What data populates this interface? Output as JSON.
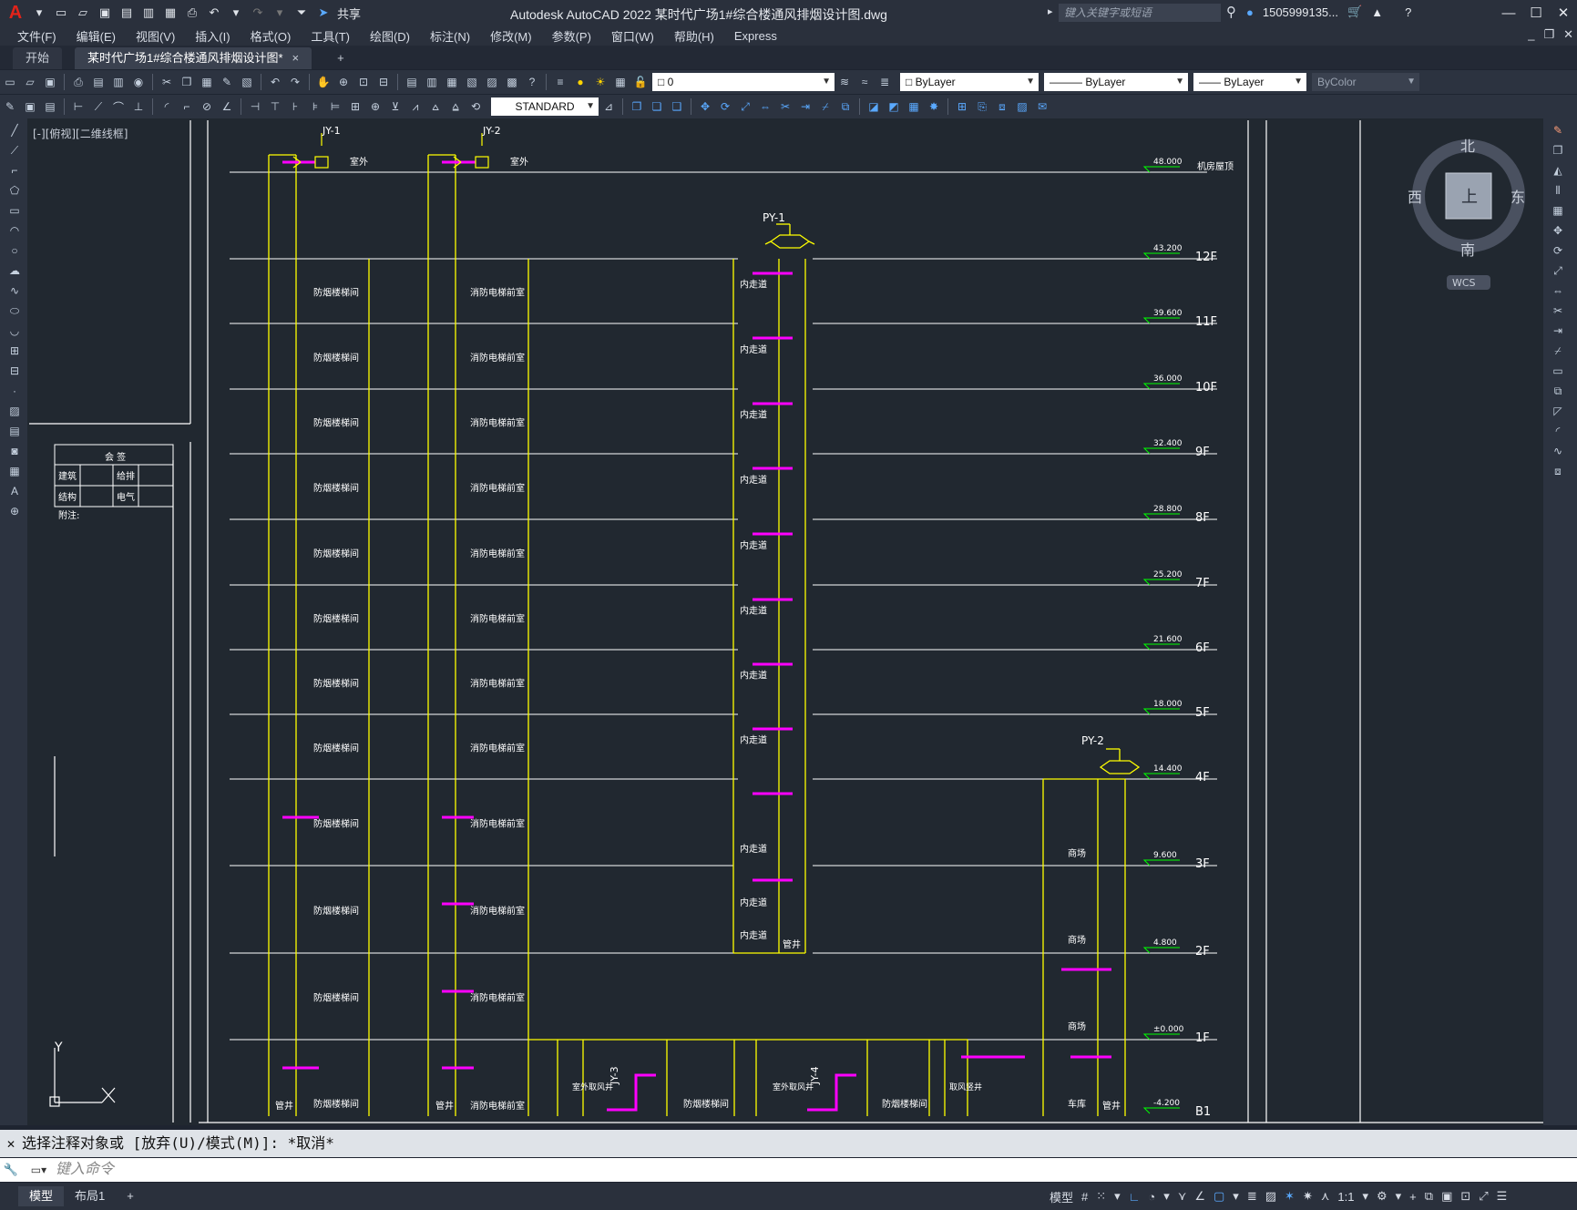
{
  "app": {
    "logo": "A",
    "title": "Autodesk AutoCAD 2022    某时代广场1#综合楼通风排烟设计图.dwg",
    "search_placeholder": "键入关键字或短语",
    "user": "1505999135..."
  },
  "menu": [
    "文件(F)",
    "编辑(E)",
    "视图(V)",
    "插入(I)",
    "格式(O)",
    "工具(T)",
    "绘图(D)",
    "标注(N)",
    "修改(M)",
    "参数(P)",
    "窗口(W)",
    "帮助(H)",
    "Express"
  ],
  "tabs": {
    "start": "开始",
    "active": "某时代广场1#综合楼通风排烟设计图*",
    "close": "×",
    "add": "+"
  },
  "share_label": "共享",
  "toolbar": {
    "layer_value": "0",
    "color_value": "ByLayer",
    "linetype_value": "ByLayer",
    "lineweight_value": "ByLayer",
    "plotstyle_value": "ByColor",
    "textstyle_value": "STANDARD"
  },
  "viewport_label": "[-][俯视][二维线框]",
  "viewcube": {
    "north": "北",
    "south": "南",
    "east": "东",
    "west": "西",
    "face": "上",
    "wcs": "WCS"
  },
  "ucs": {
    "y": "Y",
    "x": "X"
  },
  "title_table": {
    "header": "会 签",
    "r1c1": "建筑",
    "r1c2": "给排",
    "r2c1": "结构",
    "r2c2": "电气",
    "note": "附注:"
  },
  "drawing": {
    "shafts_top": [
      "JY-1",
      "JY-2"
    ],
    "outdoor": "室外",
    "py1": "PY-1",
    "py2": "PY-2",
    "jy3": "JY-3",
    "jy4": "JY-4",
    "room_stair": "防烟楼梯间",
    "room_elevator": "消防电梯前室",
    "room_corridor": "内走道",
    "room_shop": "商场",
    "room_garage": "车库",
    "pipe_well": "管井",
    "outdoor_intake": "室外取风井",
    "intake_shaft": "取风竖井",
    "levels": [
      {
        "floor": "机房屋顶",
        "elev": "48.000"
      },
      {
        "floor": "12F",
        "elev": "43.200"
      },
      {
        "floor": "11F",
        "elev": "39.600"
      },
      {
        "floor": "10F",
        "elev": "36.000"
      },
      {
        "floor": "9F",
        "elev": "32.400"
      },
      {
        "floor": "8F",
        "elev": "28.800"
      },
      {
        "floor": "7F",
        "elev": "25.200"
      },
      {
        "floor": "6F",
        "elev": "21.600"
      },
      {
        "floor": "5F",
        "elev": "18.000"
      },
      {
        "floor": "4F",
        "elev": "14.400"
      },
      {
        "floor": "3F",
        "elev": "9.600"
      },
      {
        "floor": "2F",
        "elev": "4.800"
      },
      {
        "floor": "1F",
        "elev": "±0.000"
      },
      {
        "floor": "B1",
        "elev": "-4.200"
      }
    ]
  },
  "command": {
    "history": "选择注释对象或 [放弃(U)/模式(M)]: *取消*",
    "placeholder": "键入命令"
  },
  "status": {
    "model_tab": "模型",
    "layout_tab": "布局1",
    "add": "+",
    "model_label": "模型",
    "scale": "1:1"
  },
  "colors": {
    "background": "#212830",
    "level_line": "#ffffff",
    "wall": "#ffff00",
    "duct": "#ff00ff",
    "level_marker": "#00ff00"
  }
}
